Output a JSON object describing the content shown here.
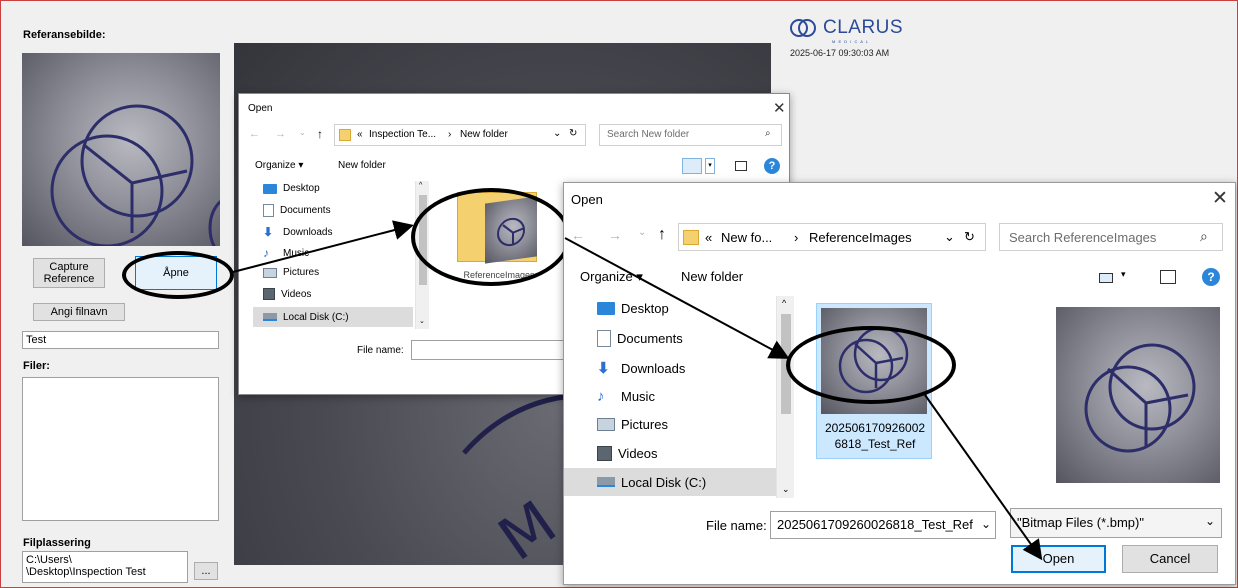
{
  "app": {
    "reference_label": "Referansebilde:",
    "capture_button": "Capture\nReference",
    "open_button": "Åpne",
    "set_filename_button": "Angi filnavn",
    "filename_value": "Test",
    "files_label": "Filer:",
    "file_location_label": "Filplassering",
    "file_location_line1": "C:\\Users\\",
    "file_location_line2": "\\Desktop\\Inspection Test",
    "browse_button": "...",
    "logo_text": "CLARUS",
    "logo_sub": "M E D I C A L",
    "timestamp": "2025-06-17 09:30:03 AM"
  },
  "dialog1": {
    "title": "Open",
    "path_prefix": "«",
    "path_part1": "Inspection Te...",
    "path_sep": "›",
    "path_part2": "New folder",
    "search_placeholder": "Search New folder",
    "organize": "Organize ▾",
    "new_folder": "New folder",
    "tree": [
      "Desktop",
      "Documents",
      "Downloads",
      "Music",
      "Pictures",
      "Videos",
      "Local Disk (C:)"
    ],
    "folder_caption": "ReferenceImages",
    "file_name_label": "File name:"
  },
  "dialog2": {
    "title": "Open",
    "path_prefix": "«",
    "path_part1": "New fo...",
    "path_sep": "›",
    "path_part2": "ReferenceImages",
    "search_placeholder": "Search ReferenceImages",
    "organize": "Organize ▾",
    "new_folder": "New folder",
    "tree": [
      "Desktop",
      "Documents",
      "Downloads",
      "Music",
      "Pictures",
      "Videos",
      "Local Disk (C:)"
    ],
    "file_caption_line1": "202506170926002",
    "file_caption_line2": "6818_Test_Ref",
    "file_name_label": "File name:",
    "file_name_value": "2025061709260026818_Test_Ref",
    "filter_value": "\"Bitmap Files (*.bmp)\"",
    "open_button": "Open",
    "cancel_button": "Cancel"
  },
  "icons": {
    "close": "close-icon",
    "back": "back-arrow-icon",
    "forward": "forward-arrow-icon",
    "up": "up-arrow-icon",
    "refresh": "refresh-icon",
    "search": "search-icon",
    "help": "help-icon",
    "view": "view-menu-icon",
    "pane": "preview-pane-icon"
  },
  "colors": {
    "accent_blue": "#2b86d9",
    "app_border": "#c94040",
    "selection": "#cce8ff"
  }
}
